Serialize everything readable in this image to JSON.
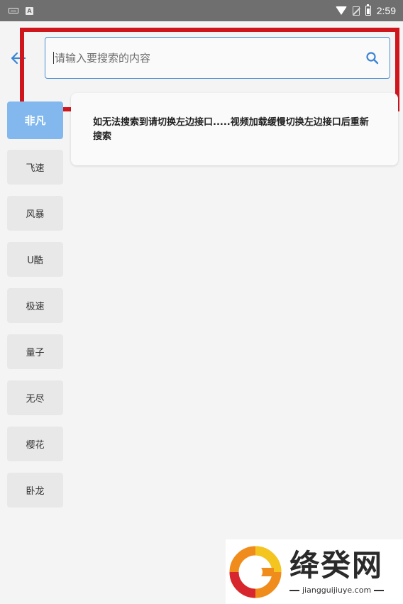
{
  "status_bar": {
    "time": "2:59",
    "notification_letter": "A"
  },
  "search": {
    "placeholder": "请输入要搜索的内容",
    "value": ""
  },
  "sources": [
    {
      "label": "非凡",
      "selected": true
    },
    {
      "label": "飞速",
      "selected": false
    },
    {
      "label": "风暴",
      "selected": false
    },
    {
      "label": "U酷",
      "selected": false
    },
    {
      "label": "极速",
      "selected": false
    },
    {
      "label": "量子",
      "selected": false
    },
    {
      "label": "无尽",
      "selected": false
    },
    {
      "label": "樱花",
      "selected": false
    },
    {
      "label": "卧龙",
      "selected": false
    }
  ],
  "notice": "如无法搜索到请切换左边接口.....视频加载缓慢切换左边接口后重新搜索",
  "watermark": {
    "title": "绛癸网",
    "url": "jiangguijiuye.com"
  },
  "colors": {
    "accent": "#4a8fd4",
    "selected_source": "#82b8ee",
    "highlight": "#d0161d",
    "status_bar": "#6f6f6f"
  },
  "icons": {
    "back": "arrow-left-icon",
    "search": "magnifier-icon",
    "wifi": "wifi-icon",
    "battery": "battery-icon",
    "sim": "no-sim-icon",
    "keyboard": "keyboard-icon"
  }
}
